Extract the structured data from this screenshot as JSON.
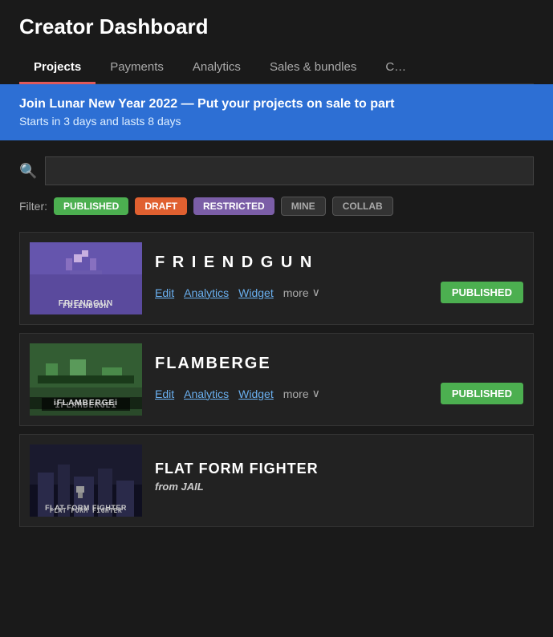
{
  "header": {
    "title": "Creator Dashboard"
  },
  "nav": {
    "tabs": [
      {
        "id": "projects",
        "label": "Projects",
        "active": true
      },
      {
        "id": "payments",
        "label": "Payments",
        "active": false
      },
      {
        "id": "analytics",
        "label": "Analytics",
        "active": false
      },
      {
        "id": "sales-bundles",
        "label": "Sales & bundles",
        "active": false
      },
      {
        "id": "more",
        "label": "C…",
        "active": false
      }
    ]
  },
  "banner": {
    "title": "Join Lunar New Year 2022",
    "dash": "—",
    "subtitle_prefix": "Put your projects on sale to part",
    "line2": "Starts in 3 days and lasts 8 days"
  },
  "search": {
    "placeholder": ""
  },
  "filter": {
    "label": "Filter:",
    "buttons": [
      {
        "id": "published",
        "label": "PUBLISHED",
        "style": "published"
      },
      {
        "id": "draft",
        "label": "DRAFT",
        "style": "draft"
      },
      {
        "id": "restricted",
        "label": "RESTRICTED",
        "style": "restricted"
      },
      {
        "id": "mine",
        "label": "MINE",
        "style": "mine"
      },
      {
        "id": "collab",
        "label": "COLLAB",
        "style": "collab"
      }
    ]
  },
  "projects": [
    {
      "id": "friendgun",
      "name": "F R I E N D G U N",
      "thumb_label": "FRIENDGUN",
      "thumb_style": "friendgun",
      "actions": [
        "Edit",
        "Analytics",
        "Widget"
      ],
      "more_label": "more",
      "status": "PUBLISHED",
      "status_style": "published"
    },
    {
      "id": "flamberge",
      "name": "FLAMBERGE",
      "thumb_label": "iFLAMBERGEi",
      "thumb_style": "flamberge",
      "actions": [
        "Edit",
        "Analytics",
        "Widget"
      ],
      "more_label": "more",
      "status": "PUBLISHED",
      "status_style": "published"
    },
    {
      "id": "flat-form-fighter",
      "name": "FLAT FORM FIGHTER",
      "thumb_label": "FLAT FORM FIGHTER",
      "thumb_style": "flatform",
      "meta_prefix": "from ",
      "meta_source": "JAIL",
      "actions": [],
      "status": "",
      "status_style": ""
    }
  ],
  "icons": {
    "search": "🔍",
    "chevron_down": "∨"
  }
}
